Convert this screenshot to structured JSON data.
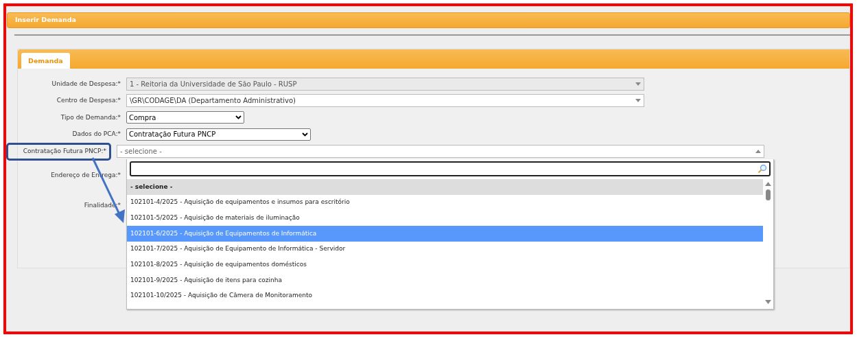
{
  "window": {
    "title": "Inserir Demanda"
  },
  "tabs": [
    {
      "label": "Demanda",
      "selected": true
    }
  ],
  "fields": [
    {
      "label": "Unidade de Despesa:*",
      "kind": "combo",
      "value": "1 - Reitoria da Universidade de São Paulo - RUSP",
      "disabled": true
    },
    {
      "label": "Centro de Despesa:*",
      "kind": "combo",
      "value": "\\GR\\CODAGE\\DA (Departamento Administrativo)",
      "disabled": false
    },
    {
      "label": "Tipo de Demanda:*",
      "kind": "select",
      "value": "Compra"
    },
    {
      "label": "Dados do PCA:*",
      "kind": "select",
      "value": "Contratação Futura PNCP"
    },
    {
      "label": "Contratação Futura PNCP:*",
      "kind": "open-combo",
      "value": "- selecione -",
      "highlighted": true
    },
    {
      "label": "Endereço de Entrega:*",
      "kind": "covered"
    },
    {
      "label": "Finalidade:*",
      "kind": "covered"
    }
  ],
  "dropdown": {
    "options": [
      {
        "label": "- selecione -",
        "kind": "placeholder",
        "selected": false
      },
      {
        "label": "102101-4/2025 - Aquisição de equipamentos e insumos para escritório",
        "kind": "item",
        "selected": false
      },
      {
        "label": "102101-5/2025 - Aquisição de materiais de iluminação",
        "kind": "item",
        "selected": false
      },
      {
        "label": "102101-6/2025 - Aquisição de Equipamentos de Informática",
        "kind": "item",
        "selected": true
      },
      {
        "label": "102101-7/2025 - Aquisição de Equipamento de Informática - Servidor",
        "kind": "item",
        "selected": false
      },
      {
        "label": "102101-8/2025 - Aquisição de equipamentos domésticos",
        "kind": "item",
        "selected": false
      },
      {
        "label": "102101-9/2025 - Aquisição de itens para cozinha",
        "kind": "item",
        "selected": false
      },
      {
        "label": "102101-10/2025 - Aquisição de Câmera de Monitoramento",
        "kind": "item",
        "selected": false
      }
    ]
  }
}
